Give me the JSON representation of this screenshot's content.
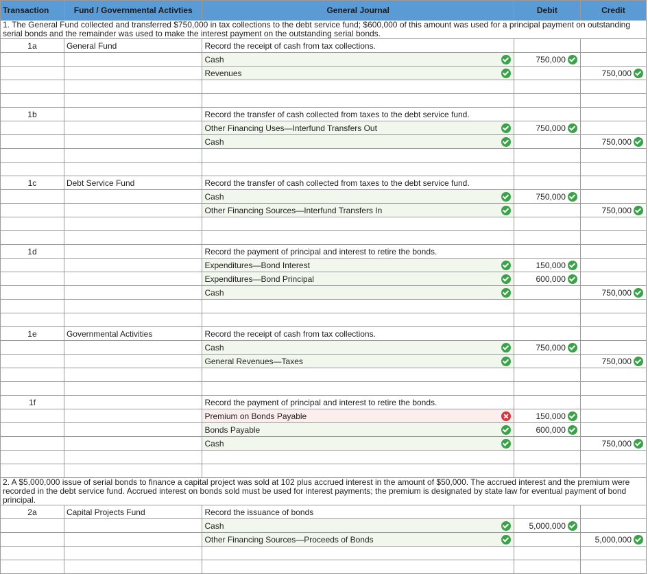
{
  "headers": {
    "transaction": "Transaction",
    "fund": "Fund / Governmental Activties",
    "journal": "General Journal",
    "debit": "Debit",
    "credit": "Credit"
  },
  "problems": [
    {
      "note": "1. The General Fund collected and transferred $750,000 in tax collections to the debt service fund; $600,000 of this amount was used for a principal payment on outstanding serial bonds and the remainder was used to make the interest payment on the outstanding serial bonds.",
      "entries": [
        {
          "id": "1a",
          "fund": "General Fund",
          "description": "Record the receipt of cash from tax collections.",
          "lines": [
            {
              "account": "Cash",
              "status": "correct",
              "debit": "750,000",
              "credit": ""
            },
            {
              "account": "Revenues",
              "status": "correct",
              "debit": "",
              "credit": "750,000"
            }
          ]
        },
        {
          "id": "1b",
          "fund": "",
          "description": "Record the transfer of cash collected from taxes to the debt service fund.",
          "lines": [
            {
              "account": "Other Financing Uses—Interfund Transfers Out",
              "status": "correct",
              "debit": "750,000",
              "credit": ""
            },
            {
              "account": "Cash",
              "status": "correct",
              "debit": "",
              "credit": "750,000"
            }
          ]
        },
        {
          "id": "1c",
          "fund": "Debt Service Fund",
          "description": "Record the transfer of cash collected from taxes to the debt service fund.",
          "lines": [
            {
              "account": "Cash",
              "status": "correct",
              "debit": "750,000",
              "credit": ""
            },
            {
              "account": "Other Financing Sources—Interfund Transfers In",
              "status": "correct",
              "debit": "",
              "credit": "750,000"
            }
          ]
        },
        {
          "id": "1d",
          "fund": "",
          "description": "Record the payment of principal and interest to retire the bonds.",
          "lines": [
            {
              "account": "Expenditures—Bond Interest",
              "status": "correct",
              "debit": "150,000",
              "credit": ""
            },
            {
              "account": "Expenditures—Bond Principal",
              "status": "correct",
              "debit": "600,000",
              "credit": ""
            },
            {
              "account": "Cash",
              "status": "correct",
              "debit": "",
              "credit": "750,000"
            }
          ]
        },
        {
          "id": "1e",
          "fund": "Governmental Activities",
          "description": "Record the receipt of cash from tax collections.",
          "lines": [
            {
              "account": "Cash",
              "status": "correct",
              "debit": "750,000",
              "credit": ""
            },
            {
              "account": "General Revenues—Taxes",
              "status": "correct",
              "debit": "",
              "credit": "750,000"
            }
          ]
        },
        {
          "id": "1f",
          "fund": "",
          "description": "Record the payment of principal and interest to retire the bonds.",
          "lines": [
            {
              "account": "Premium on Bonds Payable",
              "status": "incorrect",
              "debit": "150,000",
              "credit": ""
            },
            {
              "account": "Bonds Payable",
              "status": "correct",
              "debit": "600,000",
              "credit": ""
            },
            {
              "account": "Cash",
              "status": "correct",
              "debit": "",
              "credit": "750,000"
            }
          ]
        }
      ]
    },
    {
      "note": "2. A $5,000,000 issue of serial bonds to finance a capital project was sold at 102 plus accrued interest in the amount of $50,000. The accrued interest and the premium were recorded in the debt service fund. Accrued interest on bonds sold must be used for interest payments; the premium is designated by state law for eventual payment of bond principal.",
      "entries": [
        {
          "id": "2a",
          "fund": "Capital Projects Fund",
          "description": "Record the issuance of bonds",
          "lines": [
            {
              "account": "Cash",
              "status": "correct",
              "debit": "5,000,000",
              "credit": ""
            },
            {
              "account": "Other Financing Sources—Proceeds of Bonds",
              "status": "correct",
              "debit": "",
              "credit": "5,000,000"
            }
          ]
        }
      ]
    }
  ],
  "icons": {
    "correct": "check-circle-icon",
    "incorrect": "x-circle-icon"
  },
  "colors": {
    "header": "#5b9bd5",
    "correct": "#3aa349",
    "incorrect": "#d9343a",
    "line_bg": "#f2f7ee"
  }
}
